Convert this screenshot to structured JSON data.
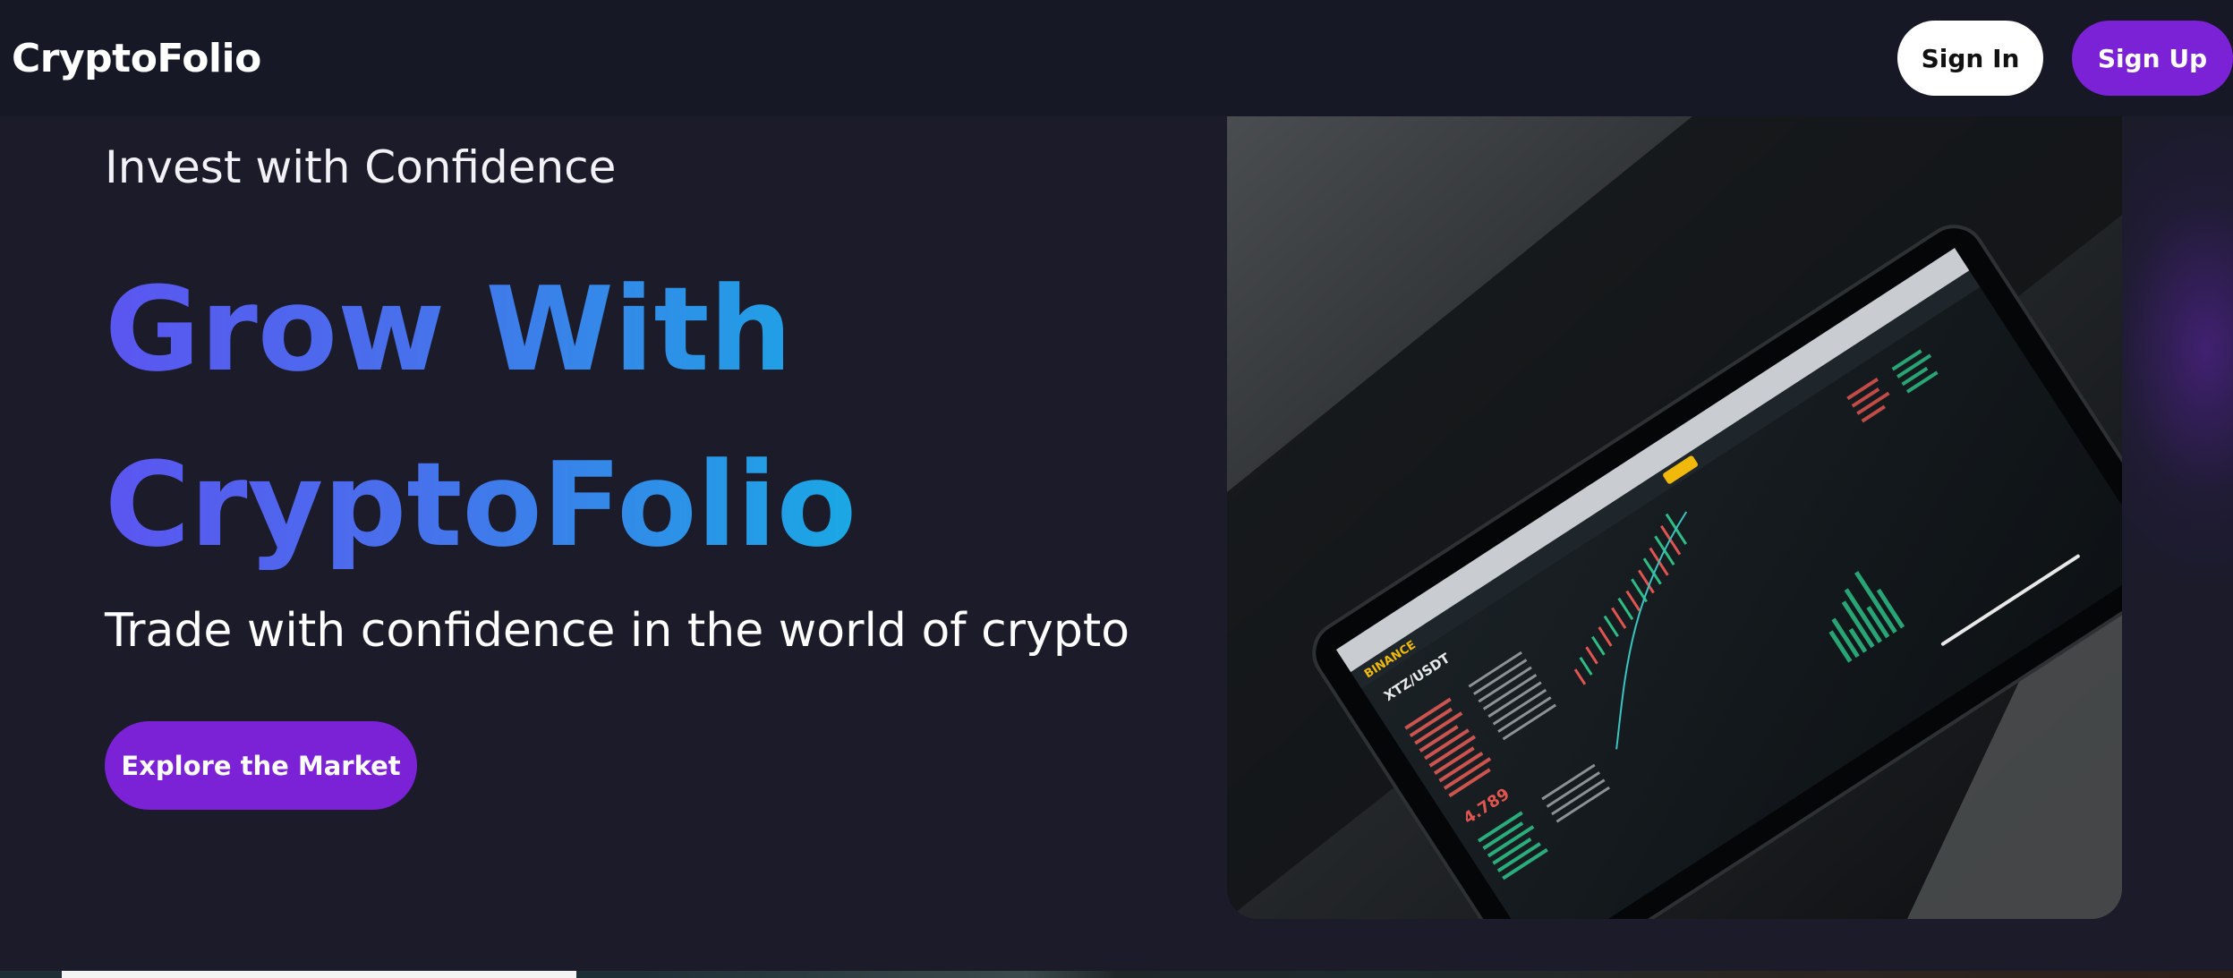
{
  "nav": {
    "logo": "CryptoFolio",
    "sign_in_label": "Sign In",
    "sign_up_label": "Sign Up"
  },
  "hero": {
    "tagline": "Invest with Confidence",
    "headline_line1": "Grow With",
    "headline_line2": "CryptoFolio",
    "subline": "Trade with confidence in the world of crypto",
    "cta_label": "Explore the Market",
    "image": {
      "description_icon": "tablet-trading-chart-image",
      "screen_brand": "BINANCE",
      "screen_pair": "XTZ/USDT",
      "screen_price": "4.789"
    }
  },
  "colors": {
    "background": "#1b1b2a",
    "navbar": "#171826",
    "accent_purple": "#7b22d6",
    "gradient_start": "#5b55f0",
    "gradient_end": "#1aa8e4"
  }
}
